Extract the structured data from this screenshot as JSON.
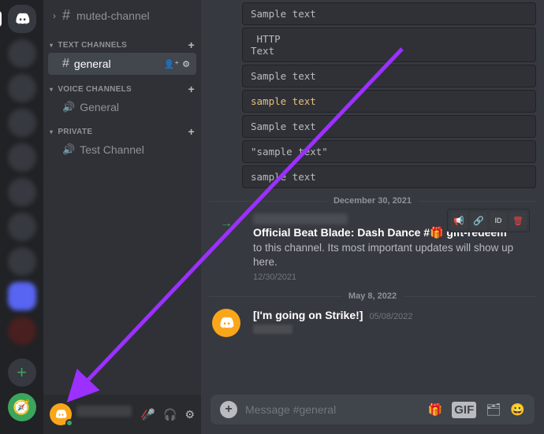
{
  "guilds": {
    "add_tooltip": "Add a Server",
    "explore_tooltip": "Explore Public Servers"
  },
  "sidebar": {
    "muted_channel": "muted-channel",
    "categories": [
      {
        "label": "TEXT CHANNELS",
        "channels": [
          {
            "type": "text",
            "label": "general",
            "active": true
          }
        ]
      },
      {
        "label": "VOICE CHANNELS",
        "channels": [
          {
            "type": "voice",
            "label": "General"
          }
        ]
      },
      {
        "label": "PRIVATE",
        "channels": [
          {
            "type": "voice",
            "label": "Test Channel"
          }
        ]
      }
    ]
  },
  "user_panel": {
    "mute_mic": "Mute",
    "deafen": "Deafen",
    "settings": "User Settings"
  },
  "messages": {
    "code_blocks": [
      "Sample text",
      " HTTP\nText",
      "Sample text",
      "sample text",
      "Sample text",
      "\"sample text\"",
      "sample text"
    ],
    "divider1": "December 30, 2021",
    "system_msg": {
      "title_prefix": "Official Beat Blade: Dash Dance #",
      "title_suffix": " gift-redeem",
      "body": " to this channel. Its most important updates will show up here.",
      "timestamp": "12/30/2021"
    },
    "divider2": "May 8, 2022",
    "strike_msg": {
      "author": "[I'm going on Strike!]",
      "timestamp": "05/08/2022"
    },
    "toolbar": {
      "speak": "Speak",
      "link": "Copy Link",
      "id": "ID",
      "trash": "Delete"
    }
  },
  "composer": {
    "placeholder": "Message #general"
  }
}
